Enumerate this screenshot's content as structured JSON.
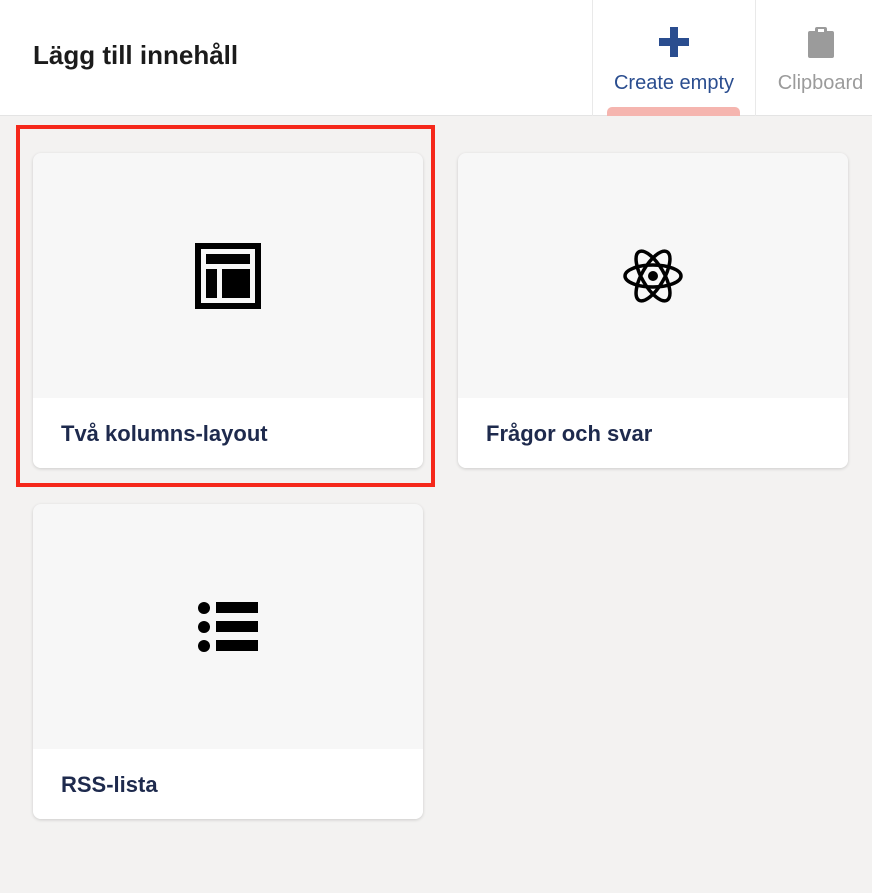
{
  "header": {
    "title": "Lägg till innehåll",
    "actions": [
      {
        "label": "Create empty",
        "icon": "plus-icon",
        "color": "#2a4d8f",
        "active": true
      },
      {
        "label": "Clipboard",
        "icon": "clipboard-icon",
        "color": "#9b9b9b",
        "active": false
      }
    ],
    "active_indicator_color": "#f5b5af"
  },
  "cards": [
    {
      "label": "Två kolumns-layout",
      "icon": "layout-icon",
      "highlighted": true
    },
    {
      "label": "Frågor och svar",
      "icon": "atom-icon",
      "highlighted": false
    },
    {
      "label": "RSS-lista",
      "icon": "list-icon",
      "highlighted": false
    }
  ],
  "colors": {
    "background": "#f3f2f1",
    "highlight": "#f5281b",
    "card_label": "#1e2a4d"
  }
}
